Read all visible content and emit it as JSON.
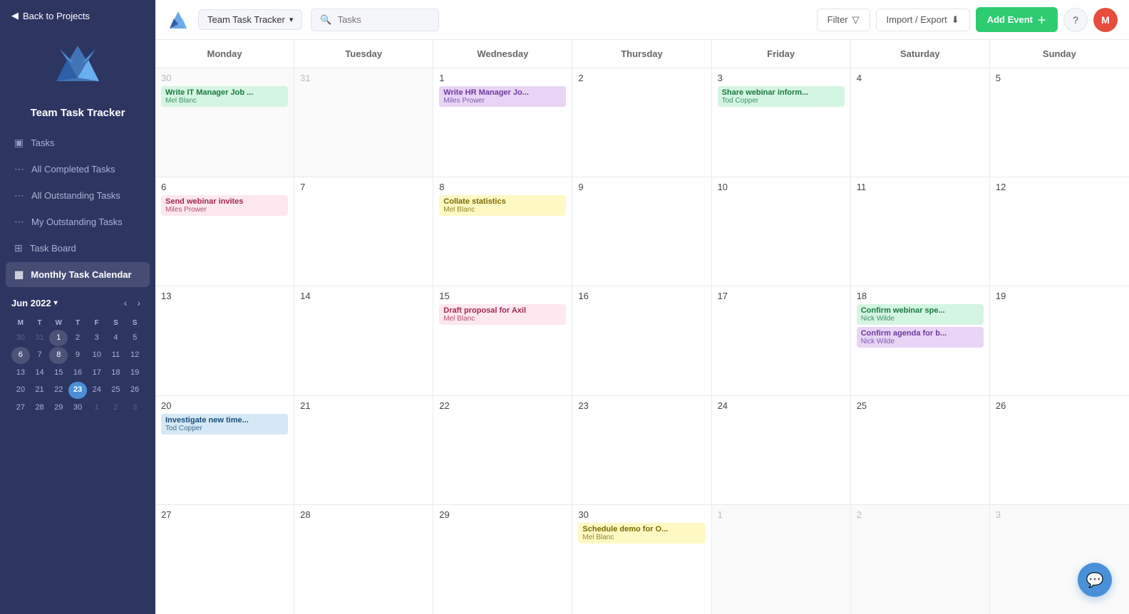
{
  "sidebar": {
    "back_label": "Back to Projects",
    "title": "Team Task Tracker",
    "nav_items": [
      {
        "id": "tasks",
        "label": "Tasks",
        "icon": "▣",
        "active": false
      },
      {
        "id": "all-completed",
        "label": "All Completed Tasks",
        "icon": "⋮",
        "active": false
      },
      {
        "id": "all-outstanding",
        "label": "All Outstanding Tasks",
        "icon": "⋮",
        "active": false
      },
      {
        "id": "my-outstanding",
        "label": "My Outstanding Tasks",
        "icon": "⋮",
        "active": false
      },
      {
        "id": "task-board",
        "label": "Task Board",
        "icon": "⊞",
        "active": false
      },
      {
        "id": "monthly-calendar",
        "label": "Monthly Task Calendar",
        "icon": "▦",
        "active": true
      }
    ],
    "mini_cal": {
      "month_label": "Jun 2022",
      "days_of_week": [
        "M",
        "T",
        "W",
        "T",
        "F",
        "S",
        "S"
      ],
      "weeks": [
        [
          {
            "day": "30",
            "other": true
          },
          {
            "day": "31",
            "other": true
          },
          {
            "day": "1",
            "today": false,
            "highlight": true
          },
          {
            "day": "2"
          },
          {
            "day": "3"
          },
          {
            "day": "4"
          },
          {
            "day": "5"
          }
        ],
        [
          {
            "day": "6"
          },
          {
            "day": "7"
          },
          {
            "day": "8"
          },
          {
            "day": "9"
          },
          {
            "day": "10"
          },
          {
            "day": "11"
          },
          {
            "day": "12"
          }
        ],
        [
          {
            "day": "13"
          },
          {
            "day": "14"
          },
          {
            "day": "15"
          },
          {
            "day": "16"
          },
          {
            "day": "17"
          },
          {
            "day": "18"
          },
          {
            "day": "19"
          }
        ],
        [
          {
            "day": "20"
          },
          {
            "day": "21"
          },
          {
            "day": "22"
          },
          {
            "day": "23",
            "today": true
          },
          {
            "day": "24"
          },
          {
            "day": "25"
          },
          {
            "day": "26"
          }
        ],
        [
          {
            "day": "27"
          },
          {
            "day": "28"
          },
          {
            "day": "29"
          },
          {
            "day": "30"
          },
          {
            "day": "1",
            "other": true
          },
          {
            "day": "2",
            "other": true
          },
          {
            "day": "3",
            "other": true
          }
        ]
      ]
    }
  },
  "topbar": {
    "project_name": "Team Task Tracker",
    "search_placeholder": "Tasks",
    "filter_label": "Filter",
    "import_label": "Import / Export",
    "add_event_label": "Add Event",
    "avatar_initial": "M"
  },
  "calendar": {
    "month_label": "June 2022",
    "days_of_week": [
      "Monday",
      "Tuesday",
      "Wednesday",
      "Thursday",
      "Friday",
      "Saturday",
      "Sunday"
    ],
    "weeks": [
      {
        "cells": [
          {
            "day": "30",
            "other": true,
            "events": [
              {
                "title": "Write IT Manager Job ...",
                "person": "Mel Blanc",
                "color": "green"
              }
            ]
          },
          {
            "day": "31",
            "other": true,
            "events": []
          },
          {
            "day": "1",
            "events": [
              {
                "title": "Write HR Manager Jo...",
                "person": "Miles Prower",
                "color": "purple"
              }
            ]
          },
          {
            "day": "2",
            "events": []
          },
          {
            "day": "3",
            "events": [
              {
                "title": "Share webinar inform...",
                "person": "Tod Copper",
                "color": "green"
              }
            ]
          },
          {
            "day": "4",
            "events": []
          },
          {
            "day": "5",
            "events": []
          }
        ]
      },
      {
        "cells": [
          {
            "day": "6",
            "events": [
              {
                "title": "Send webinar invites",
                "person": "Miles Prower",
                "color": "pink"
              }
            ]
          },
          {
            "day": "7",
            "events": []
          },
          {
            "day": "8",
            "events": [
              {
                "title": "Collate statistics",
                "person": "Mel Blanc",
                "color": "yellow"
              }
            ]
          },
          {
            "day": "9",
            "events": []
          },
          {
            "day": "10",
            "events": []
          },
          {
            "day": "11",
            "events": []
          },
          {
            "day": "12",
            "events": []
          }
        ]
      },
      {
        "cells": [
          {
            "day": "13",
            "events": []
          },
          {
            "day": "14",
            "events": []
          },
          {
            "day": "15",
            "events": [
              {
                "title": "Draft proposal for Axil",
                "person": "Mel Blanc",
                "color": "pink"
              }
            ]
          },
          {
            "day": "16",
            "events": []
          },
          {
            "day": "17",
            "events": []
          },
          {
            "day": "18",
            "events": [
              {
                "title": "Confirm webinar spe...",
                "person": "Nick Wilde",
                "color": "green"
              },
              {
                "title": "Confirm agenda for b...",
                "person": "Nick Wilde",
                "color": "purple"
              }
            ]
          },
          {
            "day": "19",
            "events": []
          }
        ]
      },
      {
        "cells": [
          {
            "day": "20",
            "events": [
              {
                "title": "Investigate new time...",
                "person": "Tod Copper",
                "color": "blue"
              }
            ]
          },
          {
            "day": "21",
            "events": []
          },
          {
            "day": "22",
            "events": []
          },
          {
            "day": "23",
            "today": true,
            "events": []
          },
          {
            "day": "24",
            "events": []
          },
          {
            "day": "25",
            "events": []
          },
          {
            "day": "26",
            "events": []
          }
        ]
      },
      {
        "cells": [
          {
            "day": "27",
            "events": []
          },
          {
            "day": "28",
            "events": []
          },
          {
            "day": "29",
            "events": []
          },
          {
            "day": "30",
            "events": [
              {
                "title": "Schedule demo for O...",
                "person": "Mel Blanc",
                "color": "yellow"
              }
            ]
          },
          {
            "day": "1",
            "other": true,
            "events": []
          },
          {
            "day": "2",
            "other": true,
            "events": []
          },
          {
            "day": "3",
            "other": true,
            "events": []
          }
        ]
      }
    ]
  },
  "chat_button_icon": "💬"
}
